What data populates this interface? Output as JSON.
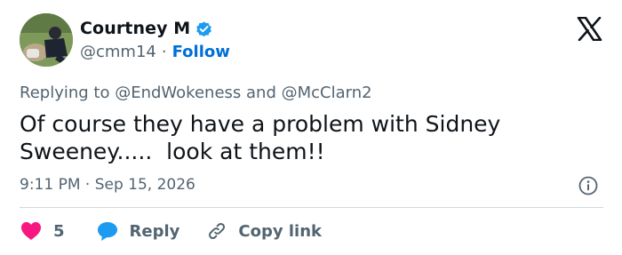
{
  "author": {
    "display_name": "Courtney M",
    "handle": "@cmm14",
    "separator": "·",
    "follow_label": "Follow",
    "avatar_icon": "user-avatar",
    "verified_icon": "verified-badge-icon",
    "verified_color": "#1d9bf0"
  },
  "brand": {
    "logo_icon": "x-logo-icon"
  },
  "reply_context": {
    "prefix": "Replying to",
    "mention_1": "@EndWokeness",
    "conjunction": "and",
    "mention_2": "@McClarn2"
  },
  "tweet": {
    "text": "Of course they have a problem with Sidney Sweeney.....  look at them!!",
    "timestamp": "9:11 PM · Sep 15, 2026"
  },
  "actions": {
    "like_count": "5",
    "like_color": "#f91880",
    "reply_label": "Reply",
    "reply_color": "#1d9bf0",
    "copy_link_label": "Copy link"
  },
  "colors": {
    "text_primary": "#0f1419",
    "text_secondary": "#536471",
    "link": "#006fd6",
    "divider": "#cfd9de"
  }
}
